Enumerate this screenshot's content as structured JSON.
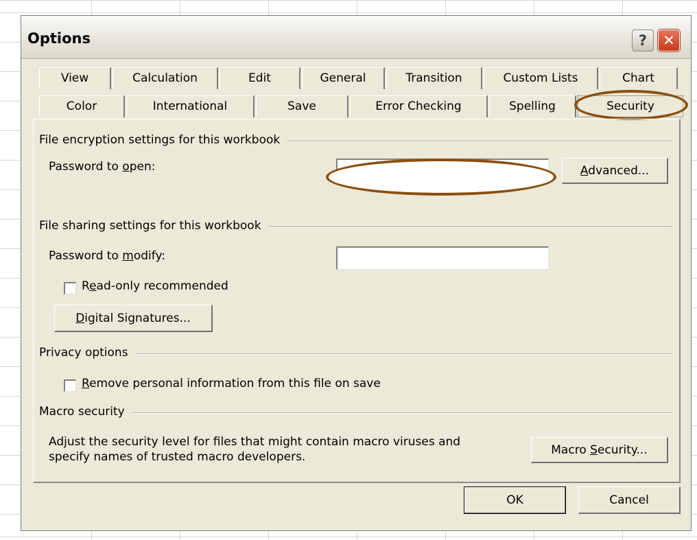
{
  "dialog": {
    "title": "Options",
    "help_glyph": "?",
    "close_glyph": "✕"
  },
  "tabs_row1": [
    "View",
    "Calculation",
    "Edit",
    "General",
    "Transition",
    "Custom Lists",
    "Chart"
  ],
  "tabs_row2": [
    "Color",
    "International",
    "Save",
    "Error Checking",
    "Spelling",
    "Security"
  ],
  "active_tab": "Security",
  "encryption": {
    "heading": "File encryption settings for this workbook",
    "password_open_prefix": "Password to ",
    "password_open_mnemonic": "o",
    "password_open_suffix": "pen:",
    "password_open_value": "",
    "advanced_mnemonic": "A",
    "advanced_rest": "dvanced..."
  },
  "sharing": {
    "heading": "File sharing settings for this workbook",
    "password_modify_prefix": "Password to ",
    "password_modify_mnemonic": "m",
    "password_modify_suffix": "odify:",
    "password_modify_value": "",
    "readonly_pre": "R",
    "readonly_mnemonic": "e",
    "readonly_rest": "ad-only recommended",
    "readonly_checked": false,
    "digsig_mnemonic": "D",
    "digsig_rest": "igital Signatures..."
  },
  "privacy": {
    "heading": "Privacy options",
    "remove_mnemonic": "R",
    "remove_rest": "emove personal information from this file on save",
    "remove_checked": false
  },
  "macro": {
    "heading": "Macro security",
    "description_line1": "Adjust the security level for files that might contain macro viruses and",
    "description_line2": "specify names of trusted macro developers.",
    "button_pre": "Macro ",
    "button_mnemonic": "S",
    "button_rest": "ecurity..."
  },
  "footer": {
    "ok_label": "OK",
    "cancel_label": "Cancel"
  },
  "colors": {
    "annotation_ring": "#8b4f10",
    "dialog_face": "#ece9d8",
    "close_button": "#c63b19"
  }
}
